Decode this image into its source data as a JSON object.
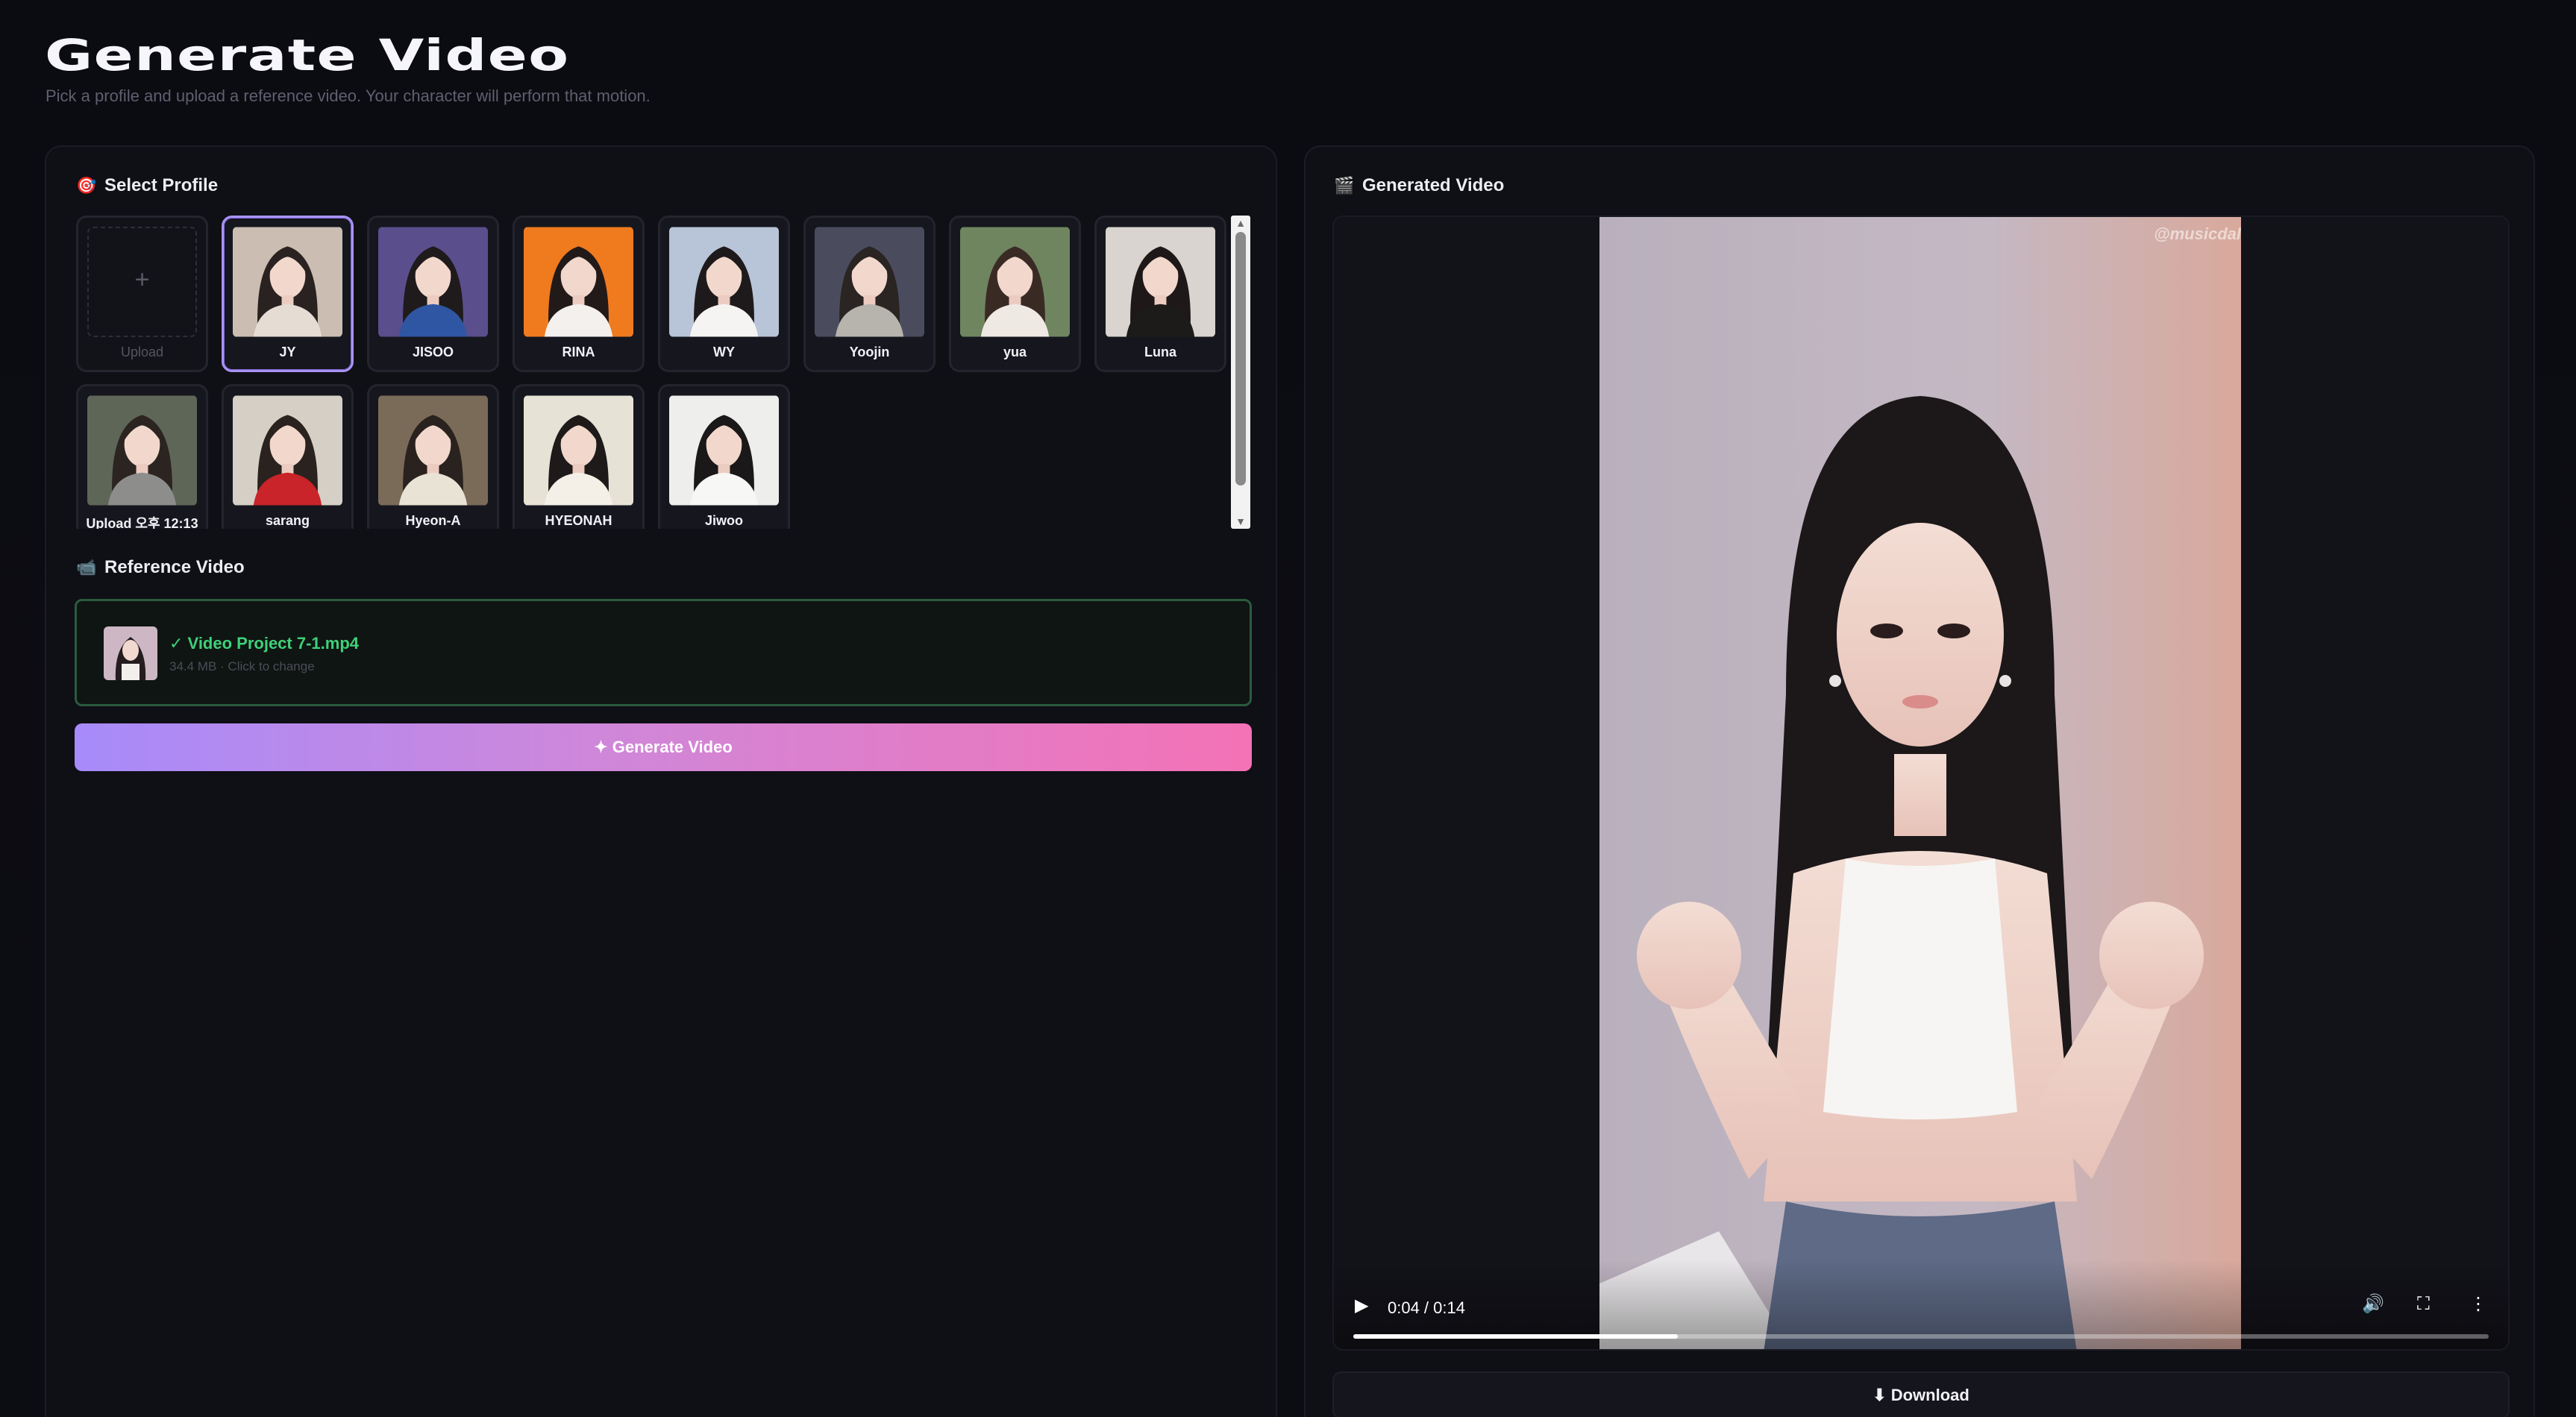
{
  "page": {
    "title": "Generate Video",
    "subtitle": "Pick a profile and upload a reference video. Your character will perform that motion."
  },
  "profile_section": {
    "icon": "target-icon",
    "title": "Select Profile",
    "upload_label": "Upload",
    "selected": "JY",
    "profiles": [
      {
        "name": "JY",
        "bg": "#cbbdb1",
        "hair": "#2a2220",
        "top": "#e5ddd4"
      },
      {
        "name": "JISOO",
        "bg": "#5a4e8c",
        "hair": "#1f1a1c",
        "top": "#2f56a3"
      },
      {
        "name": "RINA",
        "bg": "#f07a1e",
        "hair": "#221a18",
        "top": "#f3f0ee"
      },
      {
        "name": "WY",
        "bg": "#b8c4d8",
        "hair": "#1e1a1c",
        "top": "#f5f4f2"
      },
      {
        "name": "Yoojin",
        "bg": "#4a4c5e",
        "hair": "#2a2422",
        "top": "#b7b4ae"
      },
      {
        "name": "yua",
        "bg": "#6f8560",
        "hair": "#3a2a24",
        "top": "#efe9e4"
      },
      {
        "name": "Luna",
        "bg": "#d9d4cf",
        "hair": "#1e1818",
        "top": "#1d1a1a"
      },
      {
        "name": "Upload 오후 12:13",
        "bg": "#5e6658",
        "hair": "#2b2420",
        "top": "#8d8e8c"
      },
      {
        "name": "sarang",
        "bg": "#d6cfc6",
        "hair": "#2a221e",
        "top": "#c8242a"
      },
      {
        "name": "Hyeon-A",
        "bg": "#7a6a58",
        "hair": "#2a221e",
        "top": "#e9e3d5"
      },
      {
        "name": "HYEONAH",
        "bg": "#e7e2d6",
        "hair": "#1e1a1a",
        "top": "#f4f0e7"
      },
      {
        "name": "Jiwoo",
        "bg": "#eeeeec",
        "hair": "#1a1818",
        "top": "#f7f7f5"
      }
    ]
  },
  "reference_section": {
    "icon": "video-camera-icon",
    "title": "Reference Video",
    "file_name": "✓ Video Project 7-1.mp4",
    "file_meta": "34.4 MB · Click to change"
  },
  "generate_button": "✦ Generate Video",
  "output_section": {
    "icon": "clapper-icon",
    "title": "Generated Video",
    "watermark": "@musicdal",
    "time_display": "0:04 / 0:14",
    "progress_fraction": 0.2857,
    "download_label": "⬇ Download"
  },
  "colors": {
    "accent_start": "#a78bfa",
    "accent_end": "#f472b6",
    "success": "#3fd07a",
    "selected_border": "#a992f5"
  }
}
